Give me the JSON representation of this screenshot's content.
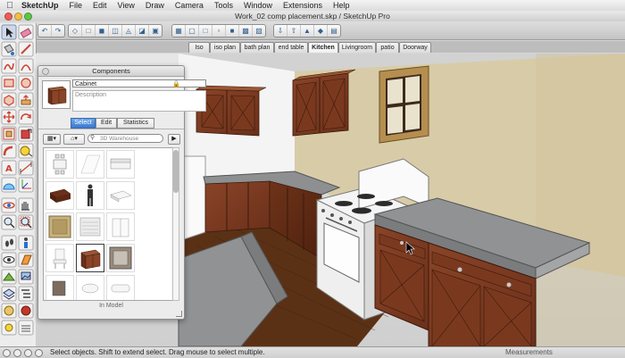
{
  "menubar": {
    "apple": "",
    "items": [
      "SketchUp",
      "File",
      "Edit",
      "View",
      "Draw",
      "Camera",
      "Tools",
      "Window",
      "Extensions",
      "Help"
    ]
  },
  "window": {
    "title": "Work_02 comp placement.skp / SketchUp Pro"
  },
  "toolbar": {
    "group1_icons": [
      "undo-icon",
      "redo-icon"
    ],
    "group2_icons": [
      "iso-view-icon",
      "top-view-icon",
      "front-view-icon",
      "right-view-icon",
      "back-view-icon",
      "left-view-icon",
      "bottom-view-icon"
    ],
    "group3_icons": [
      "xray-style-icon",
      "back-edges-style-icon",
      "wireframe-style-icon",
      "hidden-line-style-icon",
      "shaded-style-icon",
      "textured-style-icon",
      "monochrome-style-icon"
    ],
    "group4_icons": [
      "get-models-icon",
      "share-model-icon",
      "share-component-icon",
      "extension-warehouse-icon",
      "layout-icon"
    ]
  },
  "scenes": {
    "tabs": [
      "Iso",
      "iso plan",
      "bath plan",
      "end table",
      "Kitchen",
      "Livingroom",
      "patio",
      "Doorway"
    ],
    "active_index": 4
  },
  "tools": {
    "icons": [
      "select-icon",
      "eraser-icon",
      "paint-bucket-icon",
      "line-icon",
      "freehand-icon",
      "arc-icon",
      "rectangle-icon",
      "circle-icon",
      "polygon-icon",
      "push-pull-icon",
      "move-icon",
      "rotate-icon",
      "offset-icon",
      "scale-icon",
      "follow-me-icon",
      "tape-measure-icon",
      "text-icon",
      "dimension-icon",
      "protractor-icon",
      "axes-icon",
      "orbit-icon",
      "pan-icon",
      "zoom-icon",
      "zoom-extents-icon",
      "walk-icon",
      "position-camera-icon",
      "look-around-icon",
      "section-plane-icon"
    ]
  },
  "components": {
    "title": "Components",
    "name_value": "Cabinet",
    "description_placeholder": "Description",
    "tabs": [
      "Select",
      "Edit",
      "Statistics"
    ],
    "active_tab_index": 0,
    "search_placeholder": "3D Warehouse",
    "footer": "In Model",
    "thumbnails": [
      "table-chairs-thumbnail",
      "blank-thumbnail",
      "sofa-thumbnail",
      "coffee-table-thumbnail",
      "person-thumbnail",
      "bed-thumbnail",
      "rug-thumbnail",
      "radiator-thumbnail",
      "cabinet-thumbnail-alt",
      "chair-thumbnail",
      "cabinet-thumbnail",
      "rug-thumbnail-2",
      "stool-thumbnail",
      "bench-thumbnail",
      "tub-thumbnail"
    ],
    "selected_thumbnail_index": 10
  },
  "status": {
    "text": "Select objects. Shift to extend select. Drag mouse to select multiple.",
    "measurements_label": "Measurements"
  },
  "colors": {
    "cabinet_wood": "#7a3b23",
    "countertop": "#8d8f91",
    "floor": "#5a3116",
    "wall_left": "#f2f2f2",
    "wall_right": "#d9cdaa",
    "accent_blue": "#3a78cf"
  }
}
